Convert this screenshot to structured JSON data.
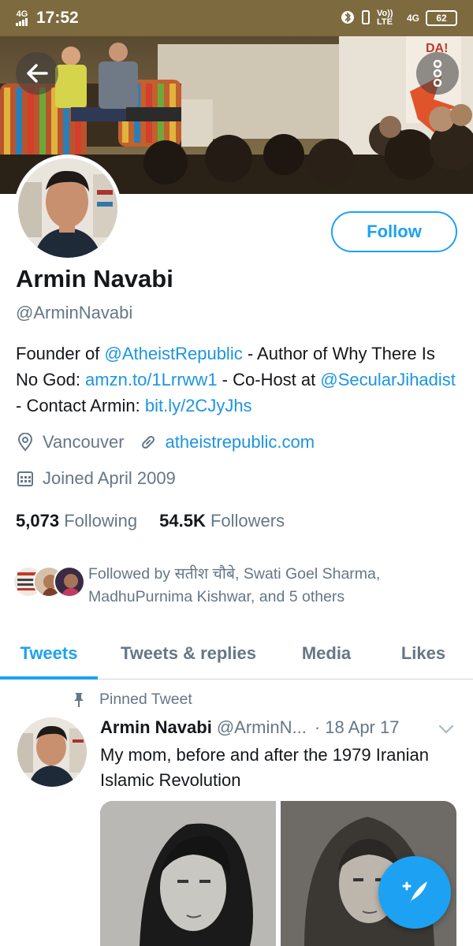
{
  "status_bar": {
    "network_left": "4G",
    "time": "17:52",
    "volte": "Vo)) LTE",
    "network_right": "4G",
    "battery": "62"
  },
  "profile": {
    "display_name": "Armin Navabi",
    "handle": "@ArminNavabi",
    "follow_label": "Follow",
    "bio": {
      "t1": "Founder of ",
      "l1": "@AtheistRepublic",
      "t2": "  -  Author of Why There Is No God: ",
      "l2": "amzn.to/1Lrrww1",
      "t3": " - Co-Host at ",
      "l3": "@SecularJihadist",
      "t4": " - Contact Armin: ",
      "l4": "bit.ly/2CJyJhs"
    },
    "location": "Vancouver",
    "website": "atheistrepublic.com",
    "joined": "Joined April 2009",
    "following_count": "5,073",
    "following_label": "Following",
    "followers_count": "54.5K",
    "followers_label": "Followers",
    "followed_by": "Followed by सतीश चौबे, Swati Goel Sharma, MadhuPurnima Kishwar, and 5 others"
  },
  "tabs": [
    {
      "label": "Tweets",
      "active": true
    },
    {
      "label": "Tweets & replies",
      "active": false
    },
    {
      "label": "Media",
      "active": false
    },
    {
      "label": "Likes",
      "active": false
    }
  ],
  "pinned_tweet": {
    "pinned_label": "Pinned Tweet",
    "author_name": "Armin Navabi",
    "author_handle": "@ArminN...",
    "date": "· 18 Apr 17",
    "text": "My mom, before and after the 1979 Iranian Islamic Revolution"
  },
  "colors": {
    "accent": "#1da1f2",
    "link": "#1b95e0",
    "secondary_text": "#657786"
  },
  "icons": {
    "back": "arrow-left-icon",
    "more": "more-vertical-icon",
    "location": "location-pin-icon",
    "website": "link-icon",
    "joined": "calendar-icon",
    "pin": "pin-icon",
    "caret": "chevron-down-icon",
    "compose": "compose-tweet-icon"
  }
}
